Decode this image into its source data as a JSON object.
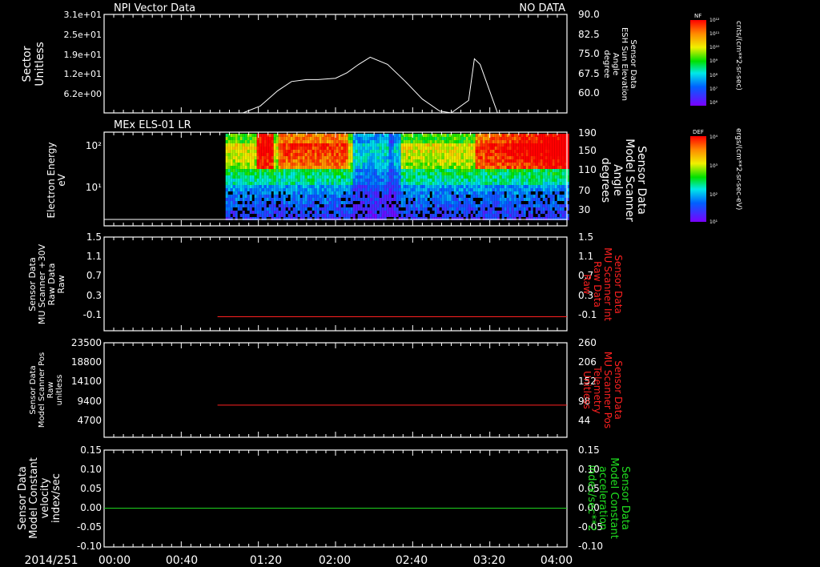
{
  "date_label": "2014/251",
  "time_ticks": [
    "00:00",
    "00:40",
    "01:20",
    "02:00",
    "02:40",
    "03:20",
    "04:00"
  ],
  "colorbars": [
    {
      "tag": "NF",
      "unit": "cnts/(cm**2-sr-sec)",
      "tick_labels": [
        "10¹²",
        "10¹¹",
        "10¹⁰",
        "10⁹",
        "10⁸",
        "10⁷",
        "10⁶"
      ]
    },
    {
      "tag": "DEF",
      "unit": "ergs/(cm**2-sr-sec-eV)",
      "tick_labels": [
        "10⁴",
        "10³",
        "10²",
        "10¹"
      ]
    }
  ],
  "panels": [
    {
      "title_left": "NPI Vector Data",
      "title_right": "NO DATA",
      "left_label": [
        "Sector",
        "Unitless"
      ],
      "left_ticks": [
        "3.1e+01",
        "2.5e+01",
        "1.9e+01",
        "1.2e+01",
        "6.2e+00"
      ],
      "right_label": [
        "Sensor Data",
        "ESH Sun Elevation",
        "Angle",
        "degree"
      ],
      "right_ticks": [
        "90.0",
        "82.5",
        "75.0",
        "67.5",
        "60.0"
      ],
      "right_label_color": "#ffffff"
    },
    {
      "title_left": "MEx ELS-01 LR",
      "left_label": [
        "Electron Energy",
        "eV"
      ],
      "left_ticks": [
        "10²",
        "10¹"
      ],
      "right_label": [
        "Sensor Data",
        "Model Scanner",
        "Angle",
        "degrees"
      ],
      "right_ticks": [
        "190",
        "150",
        "110",
        "70",
        "30"
      ],
      "right_label_color": "#ffffff"
    },
    {
      "left_label": [
        "Sensor Data",
        "MU Scanner +30V",
        "Raw Data",
        "Raw"
      ],
      "left_ticks": [
        "1.5",
        "1.1",
        "0.7",
        "0.3",
        "-0.1"
      ],
      "right_label": [
        "Sensor Data",
        "MU Scanner Int",
        "Raw Data",
        "Raw"
      ],
      "right_ticks": [
        "1.5",
        "1.1",
        "0.7",
        "0.3",
        "-0.1"
      ],
      "right_label_color": "#ff2020"
    },
    {
      "left_label": [
        "Sensor Data",
        "Model Scanner Pos",
        "Raw",
        "unitless"
      ],
      "left_ticks": [
        "23500",
        "18800",
        "14100",
        "9400",
        "4700"
      ],
      "right_label": [
        "Sensor Data",
        "MU Scanner Pos",
        "Telemetry",
        "Unitless"
      ],
      "right_ticks": [
        "260",
        "206",
        "152",
        "98",
        "44"
      ],
      "right_label_color": "#ff2020"
    },
    {
      "left_label": [
        "Sensor Data",
        "Model Constant",
        "velocity",
        "index/sec"
      ],
      "left_ticks": [
        "0.15",
        "0.10",
        "0.05",
        "0.00",
        "-0.05",
        "-0.10"
      ],
      "right_label": [
        "Sensor Data",
        "Model Constant",
        "acceleration",
        "index/sec**2"
      ],
      "right_ticks": [
        "0.15",
        "0.10",
        "0.05",
        "0.00",
        "-0.05",
        "-0.10"
      ],
      "right_label_color": "#20e020"
    }
  ],
  "chart_data": [
    {
      "type": "line",
      "name": "Sensor Data ESH Sun Elevation Angle",
      "x_unit": "hours since 00:00",
      "xlim": [
        0,
        4
      ],
      "ylim": [
        54.5,
        90.0
      ],
      "x": [
        0.0,
        1.2,
        1.35,
        1.5,
        1.62,
        1.75,
        1.85,
        2.0,
        2.1,
        2.2,
        2.3,
        2.45,
        2.6,
        2.75,
        2.9,
        3.0,
        3.15,
        3.2,
        3.25,
        3.4,
        4.0
      ],
      "y": [
        54.5,
        54.5,
        57.0,
        62.5,
        65.8,
        66.5,
        66.5,
        67.0,
        69.0,
        72.0,
        74.6,
        72.0,
        66.0,
        59.5,
        55.2,
        54.5,
        59.0,
        74.0,
        72.0,
        54.5,
        54.5
      ],
      "color": "#ffffff"
    },
    {
      "type": "heatmap",
      "name": "MEx ELS-01 LR",
      "xlim": [
        0,
        4
      ],
      "data_start": 1.05,
      "data_end": 4.0,
      "color_scale": "DEF"
    },
    {
      "type": "line",
      "name": "Sensor Data MU Scanner Int Raw Data",
      "xlim": [
        0,
        4
      ],
      "ylim": [
        -0.3,
        1.5
      ],
      "x": [
        0.98,
        4.0
      ],
      "y": [
        -0.03,
        -0.03
      ],
      "color": "#ff2020"
    },
    {
      "type": "line",
      "name": "Sensor Data MU Scanner Pos Telemetry",
      "xlim": [
        0,
        4
      ],
      "ylim": [
        0,
        23500
      ],
      "x": [
        0.98,
        4.0
      ],
      "y": [
        8000,
        8000
      ],
      "color": "#ff2020"
    },
    {
      "type": "line",
      "name": "Sensor Data Model Constant velocity",
      "xlim": [
        0,
        4
      ],
      "ylim": [
        -0.1,
        0.15
      ],
      "x": [
        0.0,
        4.0
      ],
      "y": [
        0.0,
        0.0
      ],
      "color": "#20e020"
    }
  ]
}
